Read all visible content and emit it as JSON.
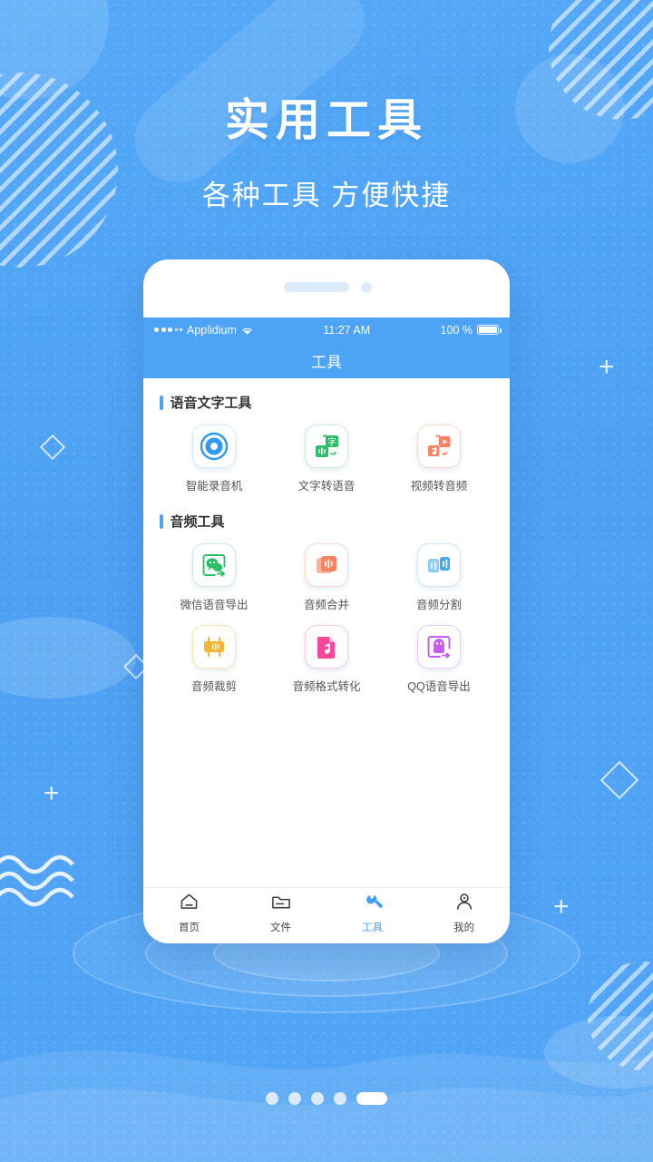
{
  "header": {
    "title": "实用工具",
    "subtitle": "各种工具 方便快捷"
  },
  "phone": {
    "status_bar": {
      "carrier": "Applidium",
      "time": "11:27 AM",
      "battery_percent": "100 %",
      "wifi_icon": "wifi-icon",
      "signal_icon": "signal-dots-icon",
      "battery_icon": "battery-full-icon"
    },
    "navbar": {
      "title": "工具"
    },
    "sections": [
      {
        "title": "语音文字工具",
        "items": [
          {
            "label": "智能录音机",
            "icon": "recorder-disc-icon",
            "color": "#2e9bf0"
          },
          {
            "label": "文字转语音",
            "icon": "text-to-speech-icon",
            "color": "#2cbf6a"
          },
          {
            "label": "视频转音频",
            "icon": "video-to-audio-icon",
            "color": "#fa8263"
          }
        ]
      },
      {
        "title": "音频工具",
        "items": [
          {
            "label": "微信语音导出",
            "icon": "wechat-export-icon",
            "color": "#2cbf6a"
          },
          {
            "label": "音频合并",
            "icon": "audio-merge-icon",
            "color": "#fa8263"
          },
          {
            "label": "音频分割",
            "icon": "audio-split-icon",
            "color": "#49b0f5"
          },
          {
            "label": "音频裁剪",
            "icon": "audio-trim-icon",
            "color": "#f5b731"
          },
          {
            "label": "音频格式转化",
            "icon": "audio-convert-icon",
            "color": "#f4479a"
          },
          {
            "label": "QQ语音导出",
            "icon": "qq-export-icon",
            "color": "#c55cf0"
          }
        ]
      }
    ],
    "tabs": [
      {
        "label": "首页",
        "icon": "home-icon",
        "active": false
      },
      {
        "label": "文件",
        "icon": "folder-icon",
        "active": false
      },
      {
        "label": "工具",
        "icon": "wrench-icon",
        "active": true
      },
      {
        "label": "我的",
        "icon": "person-icon",
        "active": false
      }
    ]
  },
  "pager": {
    "count": 5,
    "active_index": 4
  },
  "theme": {
    "background_blue": "#4da3f5",
    "accent": "#4da3f5",
    "phone_body": "#ffffff"
  }
}
